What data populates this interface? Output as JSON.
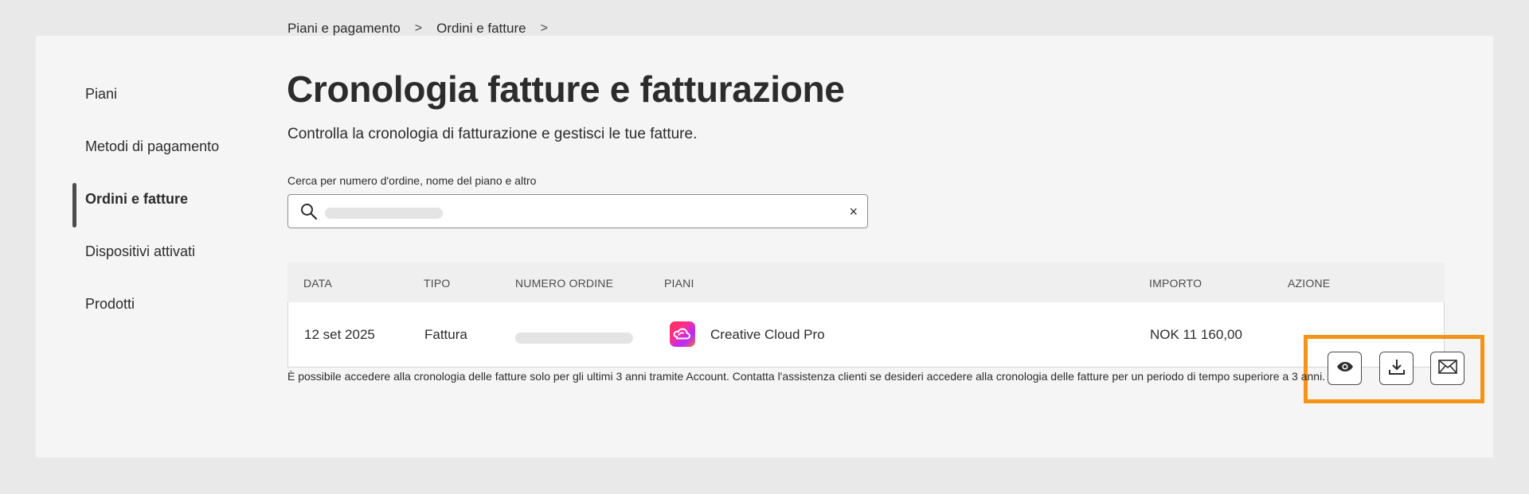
{
  "sidebar": {
    "items": [
      {
        "label": "Piani"
      },
      {
        "label": "Metodi di pagamento"
      },
      {
        "label": "Ordini e fatture"
      },
      {
        "label": "Dispositivi attivati"
      },
      {
        "label": "Prodotti"
      }
    ],
    "active_index": 2
  },
  "breadcrumb": {
    "items": [
      "Piani e pagamento",
      "Ordini e fatture"
    ],
    "separator": ">"
  },
  "header": {
    "title": "Cronologia fatture e fatturazione",
    "subtitle": "Controlla la cronologia di fatturazione e gestisci le tue fatture."
  },
  "search": {
    "label": "Cerca per numero d'ordine, nome del piano e altro",
    "value": "",
    "clear_icon": "×"
  },
  "table": {
    "columns": [
      "DATA",
      "TIPO",
      "NUMERO ORDINE",
      "PIANI",
      "IMPORTO",
      "AZIONE"
    ],
    "rows": [
      {
        "date": "12 set 2025",
        "type": "Fattura",
        "order_number": "",
        "plan": "Creative Cloud Pro",
        "amount": "NOK 11 160,00",
        "actions": [
          "eye-icon",
          "download-icon",
          "mail-icon"
        ]
      }
    ]
  },
  "footnote": "È possibile accedere alla cronologia delle fatture solo per gli ultimi 3 anni tramite Account. Contatta l'assistenza clienti se desideri accedere alla cronologia delle fatture per un periodo di tempo superiore a 3 anni.",
  "colors": {
    "highlight": "#f39317",
    "background": "#e9e9e9",
    "panel": "#f5f5f5"
  }
}
